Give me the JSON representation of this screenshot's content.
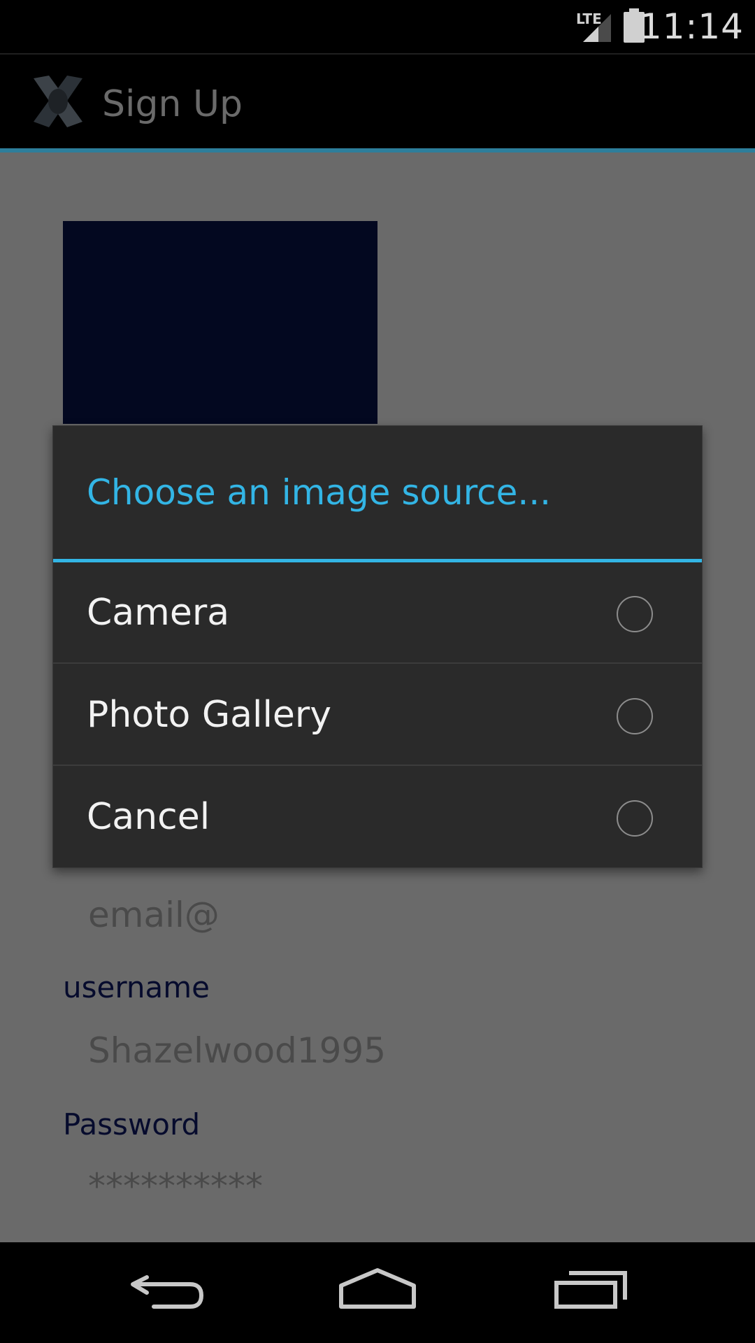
{
  "status_bar": {
    "network": "LTE",
    "time": "11:14"
  },
  "action_bar": {
    "title": "Sign Up"
  },
  "form": {
    "email_hint": "email@",
    "username_label": "username",
    "username_value": "Shazelwood1995",
    "password_label": "Password",
    "password_value": "**********"
  },
  "dialog": {
    "title": "Choose an image source...",
    "options": [
      {
        "label": "Camera",
        "selected": false
      },
      {
        "label": "Photo Gallery",
        "selected": false
      },
      {
        "label": "Cancel",
        "selected": false
      }
    ]
  },
  "colors": {
    "accent": "#33b5e5",
    "dialog_background": "#2a2a2a",
    "dim_overlay": "#6a6a6a",
    "profile_image": "#030820"
  },
  "icons": [
    "lte-signal-icon",
    "battery-icon",
    "app-logo-icon",
    "back-icon",
    "home-icon",
    "recent-apps-icon"
  ]
}
